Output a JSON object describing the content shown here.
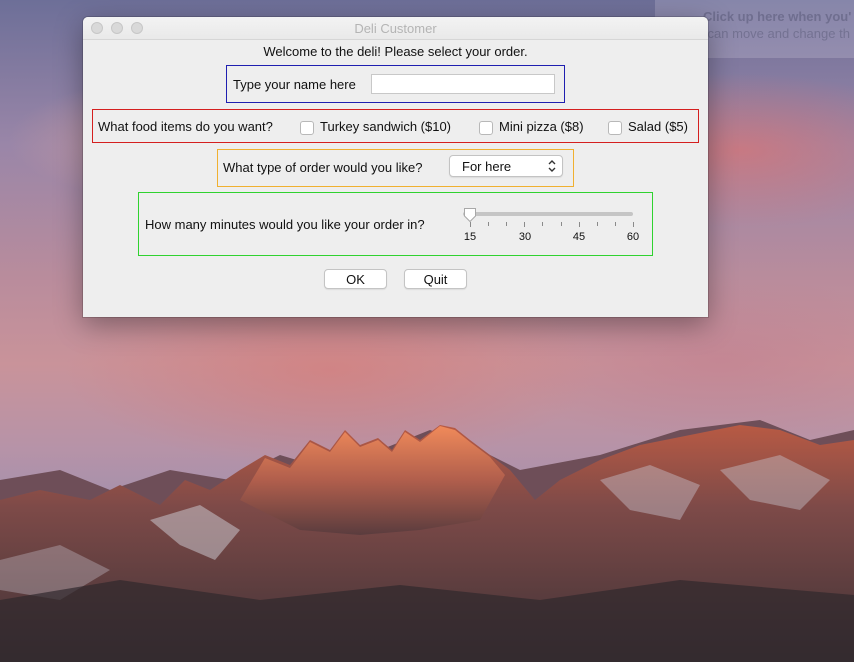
{
  "window": {
    "title": "Deli Customer",
    "welcome": "Welcome to the deli! Please select your order."
  },
  "name_panel": {
    "label": "Type your name here",
    "value": "",
    "border_color": "#1f1fb0"
  },
  "food_panel": {
    "label": "What food items do you want?",
    "border_color": "#d41f1f",
    "items": [
      {
        "label": "Turkey sandwich ($10)",
        "checked": false
      },
      {
        "label": "Mini pizza ($8)",
        "checked": false
      },
      {
        "label": "Salad ($5)",
        "checked": false
      }
    ]
  },
  "order_panel": {
    "label": "What type of order would you like?",
    "selected": "For here",
    "border_color": "#f0b030"
  },
  "minutes_panel": {
    "label": "How many minutes would you like your order in?",
    "border_color": "#2fd22f",
    "slider": {
      "min": 15,
      "max": 60,
      "value": 15,
      "labels": [
        "15",
        "30",
        "45",
        "60"
      ]
    }
  },
  "buttons": {
    "ok": "OK",
    "quit": "Quit"
  },
  "background_tooltip": {
    "line1": "Click up here when you'",
    "line2": "You can move and change th"
  }
}
